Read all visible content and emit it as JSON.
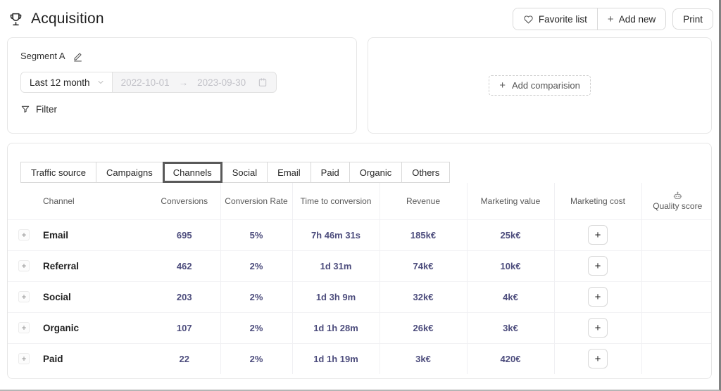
{
  "page": {
    "title": "Acquisition"
  },
  "toolbar": {
    "favorite_label": "Favorite list",
    "add_new_label": "Add new",
    "print_label": "Print"
  },
  "segment": {
    "name": "Segment A",
    "preset": "Last 12 month",
    "start_date": "2022-10-01",
    "end_date": "2023-09-30",
    "filter_label": "Filter"
  },
  "comparison": {
    "add_label": "Add comparision"
  },
  "tabs": [
    {
      "label": "Traffic source",
      "selected": false
    },
    {
      "label": "Campaigns",
      "selected": false
    },
    {
      "label": "Channels",
      "selected": true
    },
    {
      "label": "Social",
      "selected": false
    },
    {
      "label": "Email",
      "selected": false
    },
    {
      "label": "Paid",
      "selected": false
    },
    {
      "label": "Organic",
      "selected": false
    },
    {
      "label": "Others",
      "selected": false
    }
  ],
  "table": {
    "columns": [
      "Channel",
      "Conversions",
      "Conversion Rate",
      "Time to conversion",
      "Revenue",
      "Marketing value",
      "Marketing cost",
      "Quality score"
    ],
    "rows": [
      {
        "channel": "Email",
        "conversions": "695",
        "conversion_rate": "5%",
        "time_to_conversion": "7h 46m 31s",
        "revenue": "185k€",
        "marketing_value": "25k€",
        "quality_score": ""
      },
      {
        "channel": "Referral",
        "conversions": "462",
        "conversion_rate": "2%",
        "time_to_conversion": "1d 31m",
        "revenue": "74k€",
        "marketing_value": "10k€",
        "quality_score": ""
      },
      {
        "channel": "Social",
        "conversions": "203",
        "conversion_rate": "2%",
        "time_to_conversion": "1d 3h 9m",
        "revenue": "32k€",
        "marketing_value": "4k€",
        "quality_score": ""
      },
      {
        "channel": "Organic",
        "conversions": "107",
        "conversion_rate": "2%",
        "time_to_conversion": "1d 1h 28m",
        "revenue": "26k€",
        "marketing_value": "3k€",
        "quality_score": ""
      },
      {
        "channel": "Paid",
        "conversions": "22",
        "conversion_rate": "2%",
        "time_to_conversion": "1d 1h 19m",
        "revenue": "3k€",
        "marketing_value": "420€",
        "quality_score": ""
      }
    ]
  },
  "glyphs": {
    "plus": "+",
    "arrow_right": "→"
  },
  "colors": {
    "value_text": "#4d4d7d",
    "text_primary": "#262626",
    "text_secondary": "#595959",
    "border": "#d9d9d9",
    "selected_tab_border": "#595959",
    "disabled_bg": "#f5f5f6",
    "disabled_text": "#c2c2c8"
  }
}
